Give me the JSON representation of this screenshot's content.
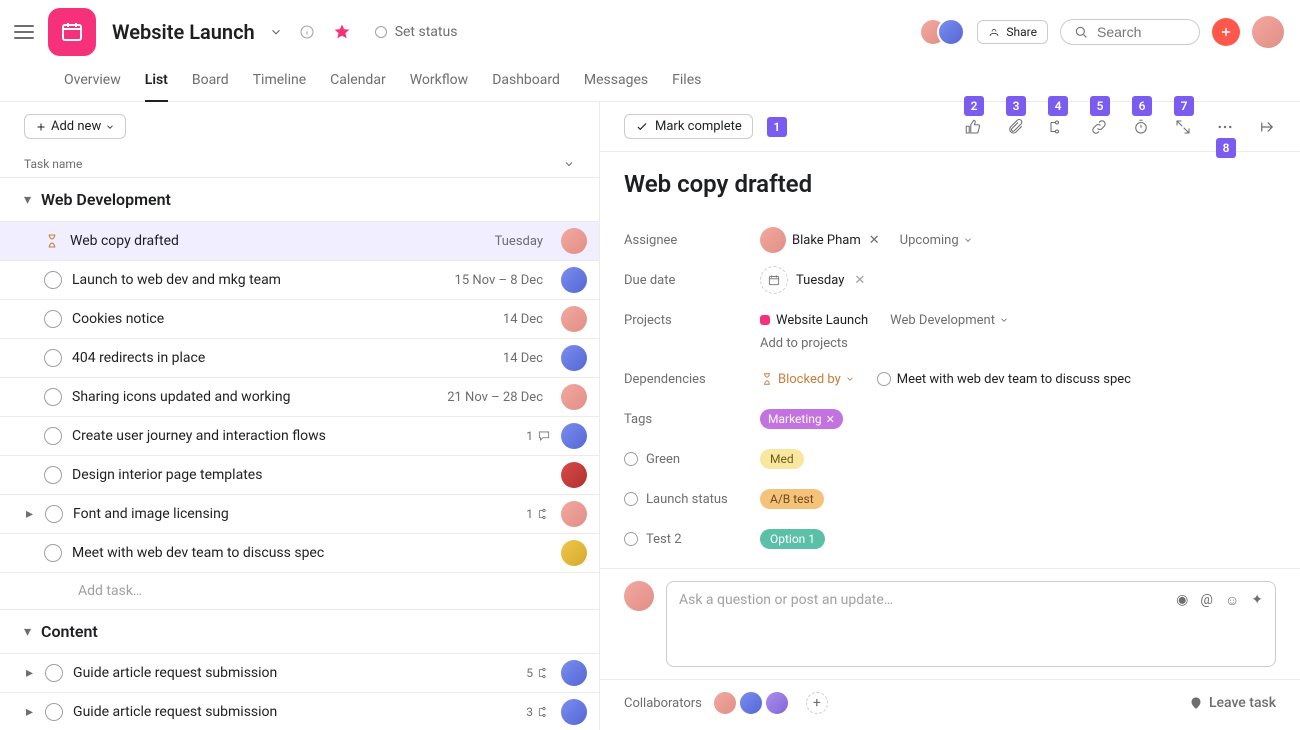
{
  "header": {
    "project_name": "Website Launch",
    "set_status": "Set status",
    "share": "Share",
    "search_placeholder": "Search"
  },
  "tabs": [
    "Overview",
    "List",
    "Board",
    "Timeline",
    "Calendar",
    "Workflow",
    "Dashboard",
    "Messages",
    "Files"
  ],
  "active_tab": "List",
  "toolbar": {
    "add_new": "Add new"
  },
  "list_header": {
    "task_name": "Task name"
  },
  "sections": [
    {
      "name": "Web Development",
      "expanded": true,
      "tasks": [
        {
          "name": "Web copy drafted",
          "date": "Tuesday",
          "avatar": "av-pink",
          "selected": true,
          "icon": "hourglass"
        },
        {
          "name": "Launch to web dev and mkg team",
          "date": "15 Nov – 8 Dec",
          "avatar": "av-blue"
        },
        {
          "name": "Cookies notice",
          "date": "14 Dec",
          "avatar": "av-pink"
        },
        {
          "name": "404 redirects in place",
          "date": "14 Dec",
          "avatar": "av-blue"
        },
        {
          "name": "Sharing icons updated and working",
          "date": "21 Nov – 28 Dec",
          "avatar": "av-pink"
        },
        {
          "name": "Create user journey and interaction flows",
          "comments": "1",
          "avatar": "av-blue"
        },
        {
          "name": "Design interior page templates",
          "avatar": "av-red"
        },
        {
          "name": "Font and image licensing",
          "subtasks": "1",
          "avatar": "av-pink",
          "expandable": true
        },
        {
          "name": "Meet with web dev team to discuss spec",
          "avatar": "av-yellow"
        }
      ],
      "add_task": "Add task…"
    },
    {
      "name": "Content",
      "expanded": true,
      "tasks": [
        {
          "name": "Guide article request submission",
          "subtasks": "5",
          "avatar": "av-blue",
          "expandable": true
        },
        {
          "name": "Guide article request submission",
          "subtasks": "3",
          "avatar": "av-blue",
          "expandable": true
        }
      ]
    }
  ],
  "detail": {
    "mark_complete": "Mark complete",
    "overlay_numbers": [
      "1",
      "2",
      "3",
      "4",
      "5",
      "6",
      "7",
      "8"
    ],
    "title": "Web copy drafted",
    "fields": {
      "assignee_label": "Assignee",
      "assignee": "Blake Pham",
      "upcoming": "Upcoming",
      "due_label": "Due date",
      "due": "Tuesday",
      "projects_label": "Projects",
      "project": "Website Launch",
      "project_section": "Web Development",
      "add_projects": "Add to projects",
      "deps_label": "Dependencies",
      "blocked_by": "Blocked by",
      "dep_task": "Meet with web dev team to discuss spec",
      "tags_label": "Tags",
      "tag": "Marketing",
      "cf1_label": "Green",
      "cf1_value": "Med",
      "cf2_label": "Launch status",
      "cf2_value": "A/B test",
      "cf3_label": "Test 2",
      "cf3_value": "Option 1"
    },
    "comment_placeholder": "Ask a question or post an update…",
    "collaborators_label": "Collaborators",
    "leave": "Leave task"
  }
}
